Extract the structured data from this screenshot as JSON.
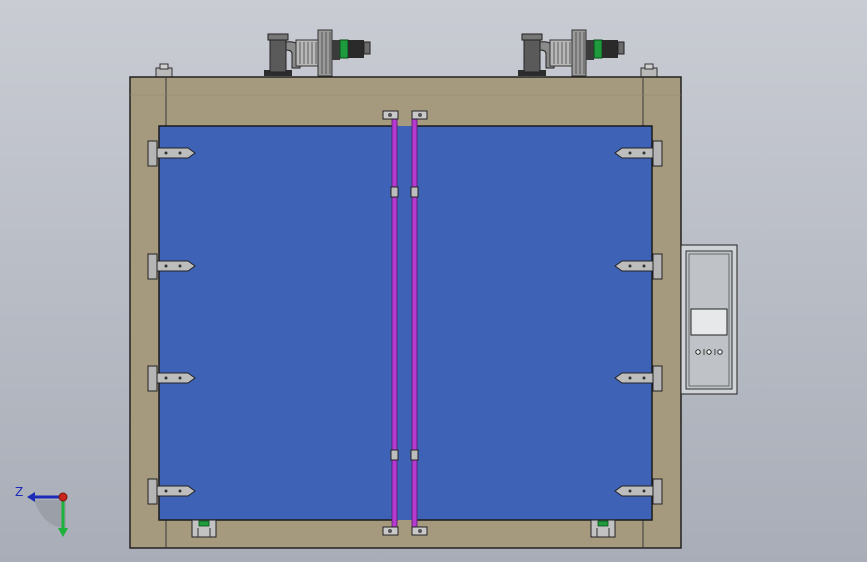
{
  "viewport": {
    "background_top": "#c9ccd3",
    "background_bottom": "#a9adb7"
  },
  "model": {
    "frame_color": "#a59a7e",
    "door_panel_color": "#3e62b6",
    "door_seal_color": "#b43ad0",
    "blower_count": 2,
    "hinges_per_side": 4,
    "control_box": {
      "panel_color": "#bfc3c8",
      "display_color": "#e6e8ea",
      "button_count": 3
    }
  },
  "triad": {
    "z_label": "Z",
    "z_color": "#1b2bb5",
    "y_color": "#1db23a",
    "origin_color": "#c8261c"
  }
}
